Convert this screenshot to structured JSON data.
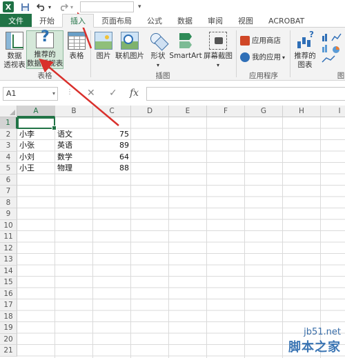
{
  "quick_access": {
    "app_icon_letter": "X",
    "save_icon": "save-icon",
    "undo_icon": "undo-icon",
    "redo_icon": "redo-icon"
  },
  "tabs": [
    {
      "label": "文件",
      "active": false
    },
    {
      "label": "开始",
      "active": false
    },
    {
      "label": "插入",
      "active": true
    },
    {
      "label": "页面布局",
      "active": false
    },
    {
      "label": "公式",
      "active": false
    },
    {
      "label": "数据",
      "active": false
    },
    {
      "label": "审阅",
      "active": false
    },
    {
      "label": "视图",
      "active": false
    },
    {
      "label": "ACROBAT",
      "active": false
    }
  ],
  "ribbon": {
    "tables_group": {
      "label": "表格",
      "pivot_line1": "数据",
      "pivot_line2": "透视表",
      "recommended_line1": "推荐的",
      "recommended_line2": "数据透视表",
      "table": "表格"
    },
    "illustrations_group": {
      "label": "插图",
      "pictures": "图片",
      "online_pictures": "联机图片",
      "shapes": "形状",
      "smartart": "SmartArt",
      "screenshot": "屏幕截图"
    },
    "apps_group": {
      "label": "应用程序",
      "store": "应用商店",
      "my_apps": "我的应用"
    },
    "charts_group": {
      "recommended_line1": "推荐的",
      "recommended_line2": "图表",
      "label_partial": "图"
    }
  },
  "formula_bar": {
    "name_box": "A1",
    "fx": "fx",
    "cancel": "✕",
    "enter": "✓"
  },
  "sheet": {
    "columns": [
      "A",
      "B",
      "C",
      "D",
      "E",
      "F",
      "G",
      "H",
      "I"
    ],
    "rows": [
      "1",
      "2",
      "3",
      "4",
      "5",
      "6",
      "7",
      "8",
      "9",
      "10",
      "11",
      "12",
      "13",
      "14",
      "15",
      "16",
      "17",
      "18",
      "19",
      "20",
      "21"
    ],
    "data": [
      [
        "",
        "",
        ""
      ],
      [
        "小李",
        "语文",
        "75"
      ],
      [
        "小张",
        "英语",
        "89"
      ],
      [
        "小刘",
        "数学",
        "64"
      ],
      [
        "小王",
        "物理",
        "88"
      ]
    ],
    "selected_cell": "A1"
  },
  "watermark": {
    "url": "jb51.net",
    "name": "脚本之家"
  },
  "colors": {
    "excel_green": "#217346",
    "arrow_red": "#d9302c"
  }
}
